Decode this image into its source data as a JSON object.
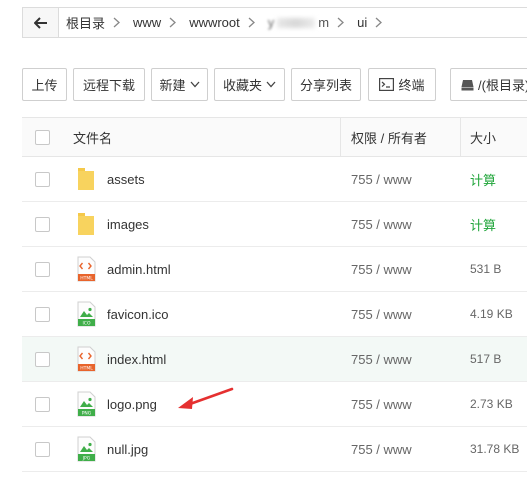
{
  "breadcrumb": {
    "back_icon": "arrow-left-icon",
    "items": [
      {
        "label": "根目录"
      },
      {
        "label": "www"
      },
      {
        "label": "wwwroot"
      },
      {
        "label": "y",
        "tail": "m"
      },
      {
        "label": "ui"
      }
    ]
  },
  "toolbar": {
    "upload": "上传",
    "remote_download": "远程下载",
    "new": "新建",
    "favorites": "收藏夹",
    "share_list": "分享列表",
    "terminal": "终端",
    "disk": "/(根目录)"
  },
  "table": {
    "headers": {
      "name": "文件名",
      "perm": "权限 / 所有者",
      "size": "大小"
    },
    "rows": [
      {
        "name": "assets",
        "icon": "folder-icon",
        "perm": "755 / www",
        "size": "计算"
      },
      {
        "name": "images",
        "icon": "folder-icon",
        "perm": "755 / www",
        "size": "计算"
      },
      {
        "name": "admin.html",
        "icon": "html-file-icon",
        "perm": "755 / www",
        "size": "531 B"
      },
      {
        "name": "favicon.ico",
        "icon": "ico-file-icon",
        "perm": "755 / www",
        "size": "4.19 KB"
      },
      {
        "name": "index.html",
        "icon": "html-file-icon",
        "perm": "755 / www",
        "size": "517 B"
      },
      {
        "name": "logo.png",
        "icon": "png-file-icon",
        "perm": "755 / www",
        "size": "2.73 KB"
      },
      {
        "name": "null.jpg",
        "icon": "jpg-file-icon",
        "perm": "755 / www",
        "size": "31.78 KB"
      }
    ]
  },
  "icon_labels": {
    "html": "HTML",
    "ico": "ICO",
    "png": "PNG",
    "jpg": "JPG"
  },
  "colors": {
    "accent_green": "#20a53a",
    "folder_yellow": "#f5c94a",
    "html_orange": "#e8642c",
    "image_green": "#3fae49",
    "arrow_red": "#e53030"
  }
}
